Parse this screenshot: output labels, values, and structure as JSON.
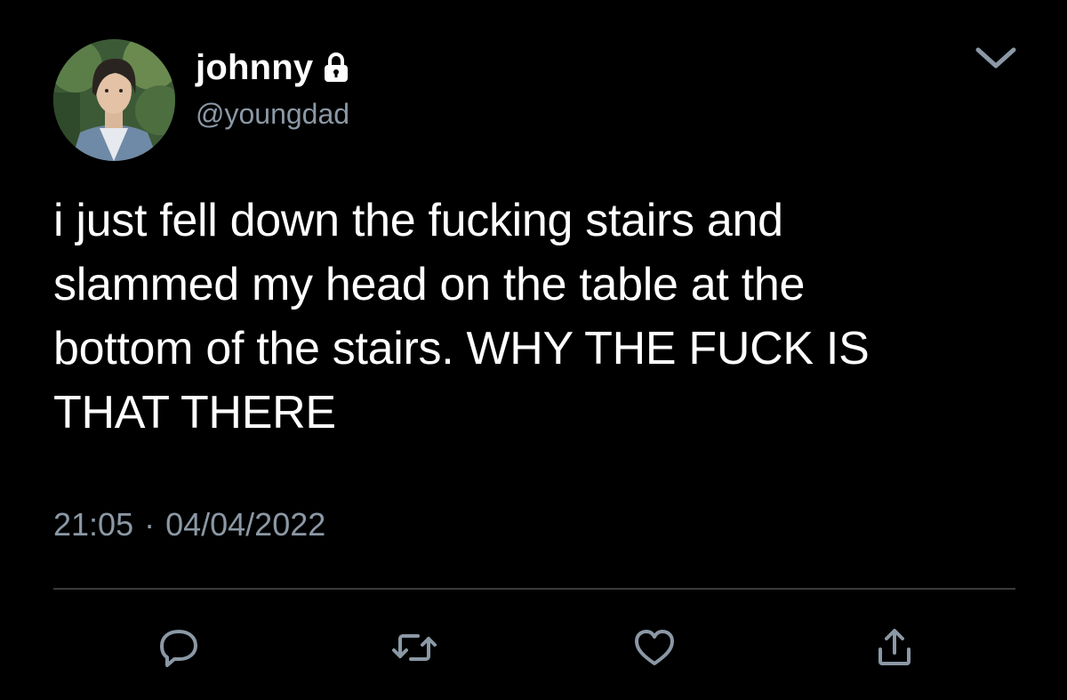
{
  "user": {
    "display_name": "johnny",
    "handle": "@youngdad",
    "protected_icon": "lock-icon",
    "avatar": "profile-photo"
  },
  "tweet": {
    "lines": [
      "i just fell down the fucking stairs and",
      "slammed my head on the table at the",
      "bottom of the stairs. WHY THE FUCK IS",
      "THAT THERE"
    ],
    "time": "21:05",
    "separator": "·",
    "date": "04/04/2022"
  },
  "actions": {
    "reply_icon": "reply-icon",
    "retweet_icon": "retweet-icon",
    "like_icon": "heart-icon",
    "share_icon": "share-icon",
    "menu_icon": "chevron-down-icon"
  },
  "colors": {
    "background": "#000000",
    "text": "#ffffff",
    "secondary": "#8b98a5",
    "divider": "#3a3a3a"
  }
}
